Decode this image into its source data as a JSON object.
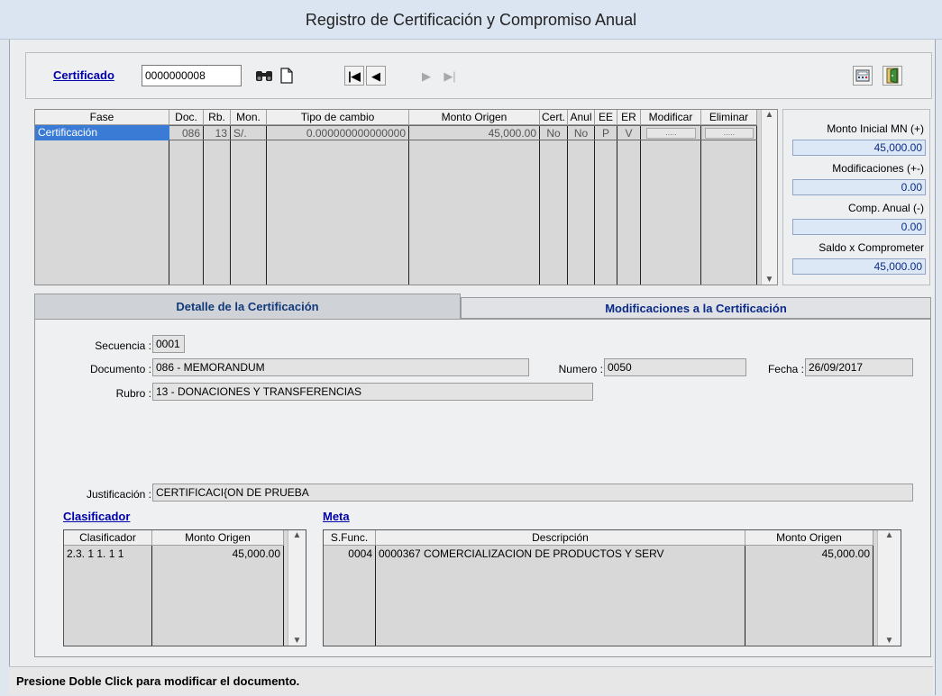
{
  "window": {
    "title": "Registro de Certificación y Compromiso Anual"
  },
  "toolbar": {
    "certificado_label": "Certificado",
    "certificado_value": "0000000008"
  },
  "grid": {
    "headers": [
      "Fase",
      "Doc.",
      "Rb.",
      "Mon.",
      "Tipo de cambio",
      "Monto Origen",
      "Cert.",
      "Anul",
      "EE",
      "ER",
      "Modificar",
      "Eliminar"
    ],
    "row": {
      "fase": "Certificación",
      "doc": "086",
      "rb": "13",
      "mon": "S/.",
      "tipo_cambio": "0.000000000000000",
      "monto": "45,000.00",
      "cert": "No",
      "anul": "No",
      "ee": "P",
      "er": "V",
      "modificar": ".....",
      "eliminar": "....."
    }
  },
  "summary": {
    "monto_inicial_label": "Monto Inicial MN (+)",
    "monto_inicial_value": "45,000.00",
    "modificaciones_label": "Modificaciones (+-)",
    "modificaciones_value": "0.00",
    "comp_anual_label": "Comp. Anual (-)",
    "comp_anual_value": "0.00",
    "saldo_label": "Saldo x Comprometer",
    "saldo_value": "45,000.00"
  },
  "tabs": {
    "detalle": "Detalle de la Certificación",
    "modificaciones": "Modificaciones a la Certificación"
  },
  "detail": {
    "secuencia_label": "Secuencia :",
    "secuencia_value": "0001",
    "documento_label": "Documento :",
    "documento_value": "086 - MEMORANDUM",
    "numero_label": "Numero :",
    "numero_value": "0050",
    "fecha_label": "Fecha :",
    "fecha_value": "26/09/2017",
    "rubro_label": "Rubro :",
    "rubro_value": "13 - DONACIONES Y TRANSFERENCIAS",
    "justificacion_label": "Justificación :",
    "justificacion_value": "CERTIFICACI{ON DE PRUEBA"
  },
  "clasificador": {
    "title": "Clasificador",
    "headers": [
      "Clasificador",
      "Monto Origen"
    ],
    "row": {
      "clasificador": "2.3. 1 1. 1 1",
      "monto": "45,000.00"
    }
  },
  "meta": {
    "title": "Meta",
    "headers": [
      "S.Func.",
      "Descripción",
      "Monto Origen"
    ],
    "row": {
      "sfunc": "0004",
      "descripcion": "0000367  COMERCIALIZACION DE PRODUCTOS Y SERV",
      "monto": "45,000.00"
    }
  },
  "status": {
    "text": "Presione Doble Click para modificar el documento."
  }
}
